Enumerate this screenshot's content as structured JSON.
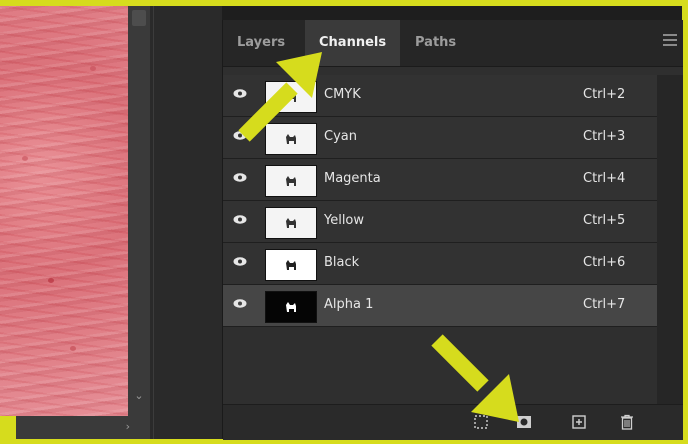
{
  "panel": {
    "tabs": [
      {
        "label": "Layers"
      },
      {
        "label": "Channels"
      },
      {
        "label": "Paths"
      }
    ],
    "active_tab": "Channels"
  },
  "channels": [
    {
      "name": "CMYK",
      "shortcut": "Ctrl+2"
    },
    {
      "name": "Cyan",
      "shortcut": "Ctrl+3"
    },
    {
      "name": "Magenta",
      "shortcut": "Ctrl+4"
    },
    {
      "name": "Yellow",
      "shortcut": "Ctrl+5"
    },
    {
      "name": "Black",
      "shortcut": "Ctrl+6"
    },
    {
      "name": "Alpha 1",
      "shortcut": "Ctrl+7",
      "selected": true
    }
  ],
  "footer_icons": [
    "load-selection-icon",
    "save-selection-icon",
    "new-channel-icon",
    "delete-icon"
  ],
  "colors": {
    "highlight": "#d6dc1d",
    "panel_bg": "#2f2f2f",
    "selected_row": "#464646",
    "canvas": "#e07f87"
  }
}
